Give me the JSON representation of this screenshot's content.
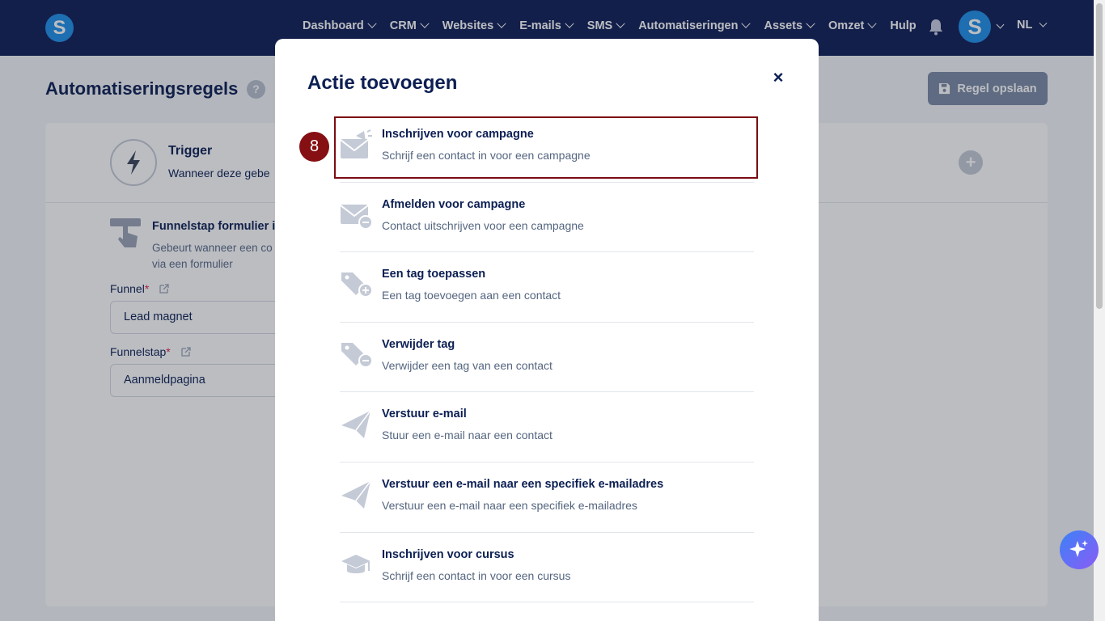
{
  "nav": {
    "logo_letter": "S",
    "items": [
      "Dashboard",
      "CRM",
      "Websites",
      "E-mails",
      "SMS",
      "Automatiseringen",
      "Assets",
      "Omzet"
    ],
    "help": "Hulp",
    "avatar_letter": "S",
    "language": "NL"
  },
  "page": {
    "title": "Automatiseringsregels",
    "help_mark": "?",
    "save_button": "Regel opslaan",
    "trigger_title": "Trigger",
    "trigger_subtitle": "Wanneer deze gebe",
    "funnel_title": "Funnelstap formulier i",
    "funnel_desc": "Gebeurt wanneer een co via een formulier",
    "funnel_label": "Funnel",
    "funnel_value": "Lead magnet",
    "funnelstap_label": "Funnelstap",
    "funnelstap_value": "Aanmeldpagina",
    "required_mark": "*"
  },
  "modal": {
    "title": "Actie toevoegen",
    "close_symbol": "×",
    "actions": [
      {
        "title": "Inschrijven voor campagne",
        "desc": "Schrijf een contact in voor een campagne",
        "icon": "mail-megaphone-icon"
      },
      {
        "title": "Afmelden voor campagne",
        "desc": "Contact uitschrijven voor een campagne",
        "icon": "mail-minus-icon"
      },
      {
        "title": "Een tag toepassen",
        "desc": "Een tag toevoegen aan een contact",
        "icon": "tag-plus-icon"
      },
      {
        "title": "Verwijder tag",
        "desc": "Verwijder een tag van een contact",
        "icon": "tag-minus-icon"
      },
      {
        "title": "Verstuur e-mail",
        "desc": "Stuur een e-mail naar een contact",
        "icon": "paper-plane-icon"
      },
      {
        "title": "Verstuur een e-mail naar een specifiek e-mailadres",
        "desc": "Verstuur een e-mail naar een specifiek e-mailadres",
        "icon": "paper-plane-icon"
      },
      {
        "title": "Inschrijven voor cursus",
        "desc": "Schrijf een contact in voor een cursus",
        "icon": "graduation-cap-icon"
      }
    ]
  },
  "step_badge": "8",
  "colors": {
    "nav_bg": "#0f1e56",
    "accent": "#1f8eea",
    "highlight": "#7a0c12",
    "icon_gray": "#c4cad6"
  }
}
